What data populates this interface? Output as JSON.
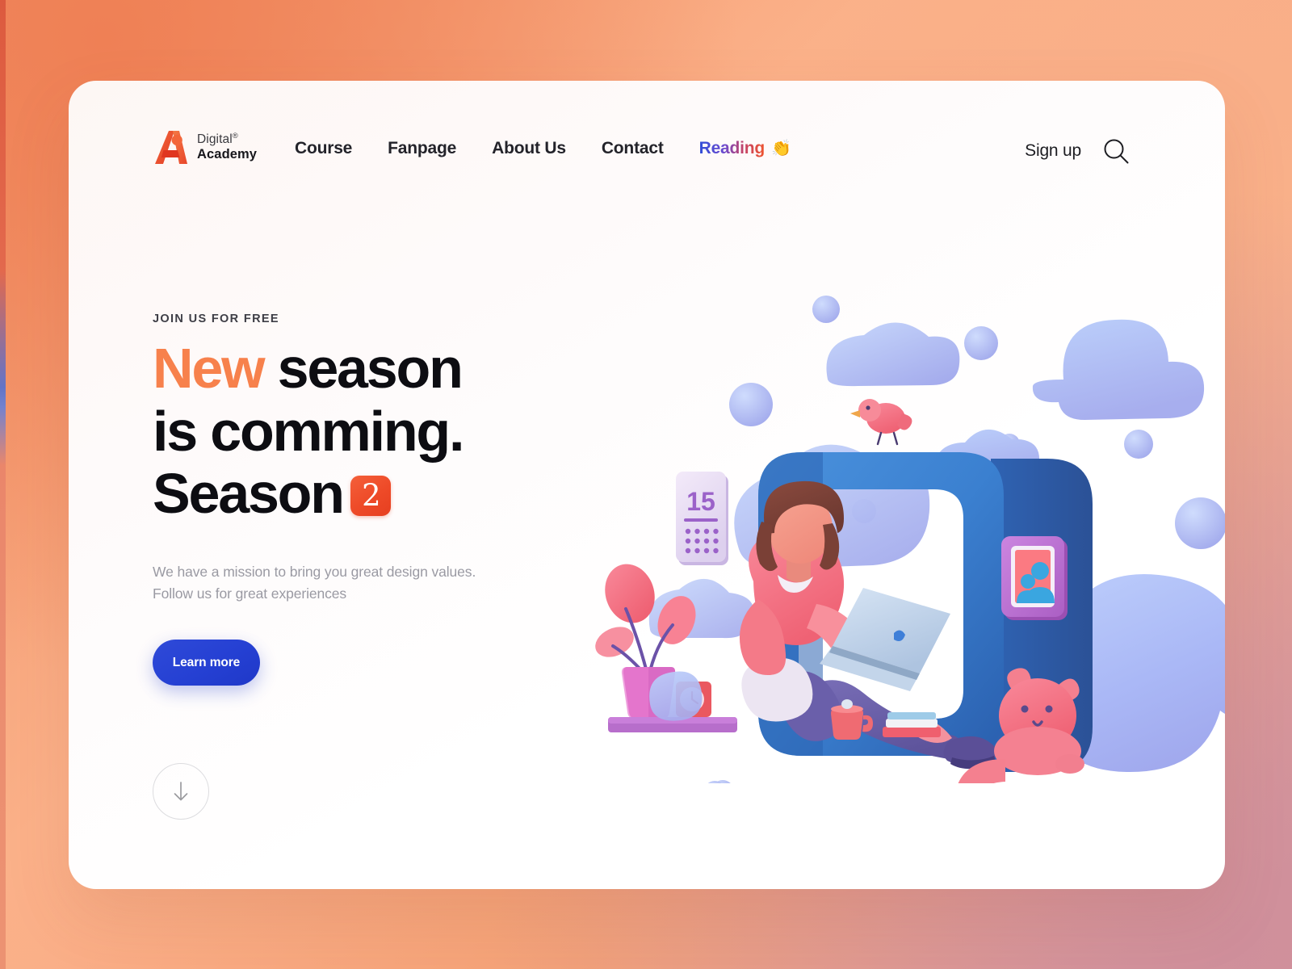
{
  "brand": {
    "logo_icon": "letter-a-logo-icon",
    "line1": "Digital",
    "registered": "®",
    "line2": "Academy"
  },
  "nav": {
    "links": [
      {
        "label": "Course"
      },
      {
        "label": "Fanpage"
      },
      {
        "label": "About Us"
      },
      {
        "label": "Contact"
      },
      {
        "label": "Reading",
        "emoji": "👏",
        "gradient": true
      }
    ],
    "signup_label": "Sign up",
    "search_icon": "search-icon"
  },
  "hero": {
    "eyebrow": "JOIN US FOR FREE",
    "headline_line1_accent": "New",
    "headline_line1_rest": "season",
    "headline_line2": "is comming.",
    "headline_line3": "Season",
    "season_badge": "2",
    "subtitle_line1": "We have a mission to bring you great design values.",
    "subtitle_line2": "Follow us for great experiences",
    "cta_label": "Learn more",
    "scroll_icon": "arrow-down-icon"
  },
  "illustration": {
    "name": "3d-woman-with-laptop-illustration",
    "calendar_day": "15",
    "elements": [
      "blue-rounded-frame",
      "woman-with-laptop",
      "pink-cat",
      "pink-bird",
      "cloud-blobs",
      "calendar-card",
      "photo-frame",
      "potted-plant",
      "alarm-clock",
      "coffee-mug",
      "book-stack"
    ]
  },
  "colors": {
    "accent_orange": "#f7814c",
    "badge_red": "#ee4a28",
    "cta_blue": "#2540d3",
    "frame_blue": "#2e6fc4",
    "cloud_periwinkle": "#aebdf4",
    "character_pink": "#f4717f",
    "page_bg_start": "#f09065",
    "page_bg_end": "#d79aa0",
    "card_bg": "#fffafa"
  }
}
